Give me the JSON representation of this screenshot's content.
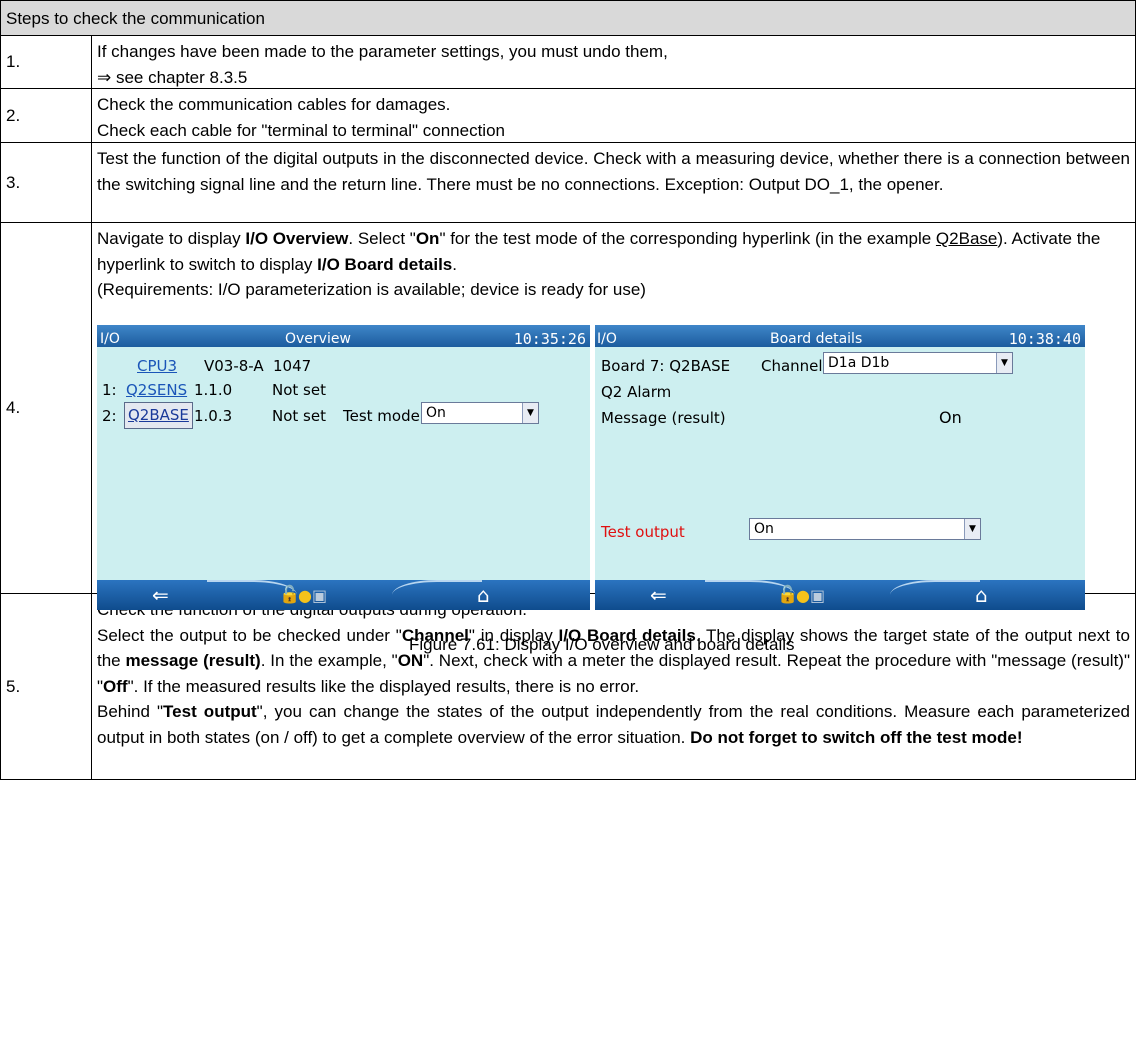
{
  "header": "Steps to check the communication",
  "steps": [
    {
      "num": "1.",
      "lines": [
        "If changes have been made to the parameter settings, you must undo them,",
        "⇒ see chapter 8.3.5"
      ]
    },
    {
      "num": "2.",
      "lines": [
        "Check the communication cables for damages.",
        "Check each cable for \"terminal to terminal\" connection"
      ]
    },
    {
      "num": "3.",
      "text": "Test the function of the digital outputs in the disconnected device. Check with a measuring device, whether there is a connection between the switching signal line and the return line. There must be no connections. Exception: Output DO_1, the opener."
    },
    {
      "num": "4.",
      "p1_a": "Navigate to display ",
      "p1_b": "I/O Overview",
      "p1_c": ". Select \"",
      "p1_d": "On",
      "p1_e": "\" for the test mode of the corresponding hyperlink (in the example ",
      "p1_f": "Q2Base",
      "p1_g": "). Activate the hyperlink to switch to display ",
      "p1_h": "I/O Board details",
      "p1_i": ".",
      "p2": "(Requirements: I/O parameterization is available; device is ready for use)",
      "caption": "Figure 7.61: Display I/O overview and board details"
    },
    {
      "num": "5.",
      "l1": "Check the function of the digital outputs during operation.",
      "s_a": "Select the output to be checked under \"",
      "s_b": "Channel",
      "s_c": "\" in display ",
      "s_d": "I/O Board details",
      "s_e": ". The display shows the target state of the output next to the ",
      "s_f": "message (result)",
      "s_g": ". In the example, \"",
      "s_h": "ON",
      "s_i": "\". Next, check with a meter the displayed result. Repeat the procedure with \"message (result)\" \"",
      "s_j": "Off",
      "s_k": "\". If the measured results like the displayed results, there is no error.",
      "t_a": "Behind \"",
      "t_b": "Test output",
      "t_c": "\", you can change the states of the output independently from the real conditions. Measure each parameterized output in both states (on / off) to get a complete overview of the error situation. ",
      "t_d": "Do not forget to switch off the test mode!"
    }
  ],
  "screen1": {
    "title_left": "I/O",
    "title_center": "Overview",
    "time": "10:35:26",
    "cpu": "CPU3",
    "cpu_ver": "V03-8-A",
    "cpu_num": "1047",
    "r1_idx": "1:",
    "r1_name": "Q2SENS",
    "r1_ver": "1.1.0",
    "r1_stat": "Not set",
    "r2_idx": "2:",
    "r2_name": "Q2BASE",
    "r2_ver": "1.0.3",
    "r2_stat": "Not set",
    "test_label": "Test mode",
    "test_val": "On"
  },
  "screen2": {
    "title_left": "I/O",
    "title_center": "Board details",
    "time": "10:38:40",
    "board": "Board 7: Q2BASE",
    "channel_label": "Channel",
    "channel_val": "D1a D1b",
    "alarm": "Q2 Alarm",
    "msg_label": "Message (result)",
    "msg_val": "On",
    "test_label": "Test output",
    "test_val": "On"
  },
  "icons": {
    "back": "back-arrow-icon",
    "lock": "lock-icon",
    "user": "user-icon",
    "monitor": "monitor-icon",
    "home": "home-icon"
  }
}
